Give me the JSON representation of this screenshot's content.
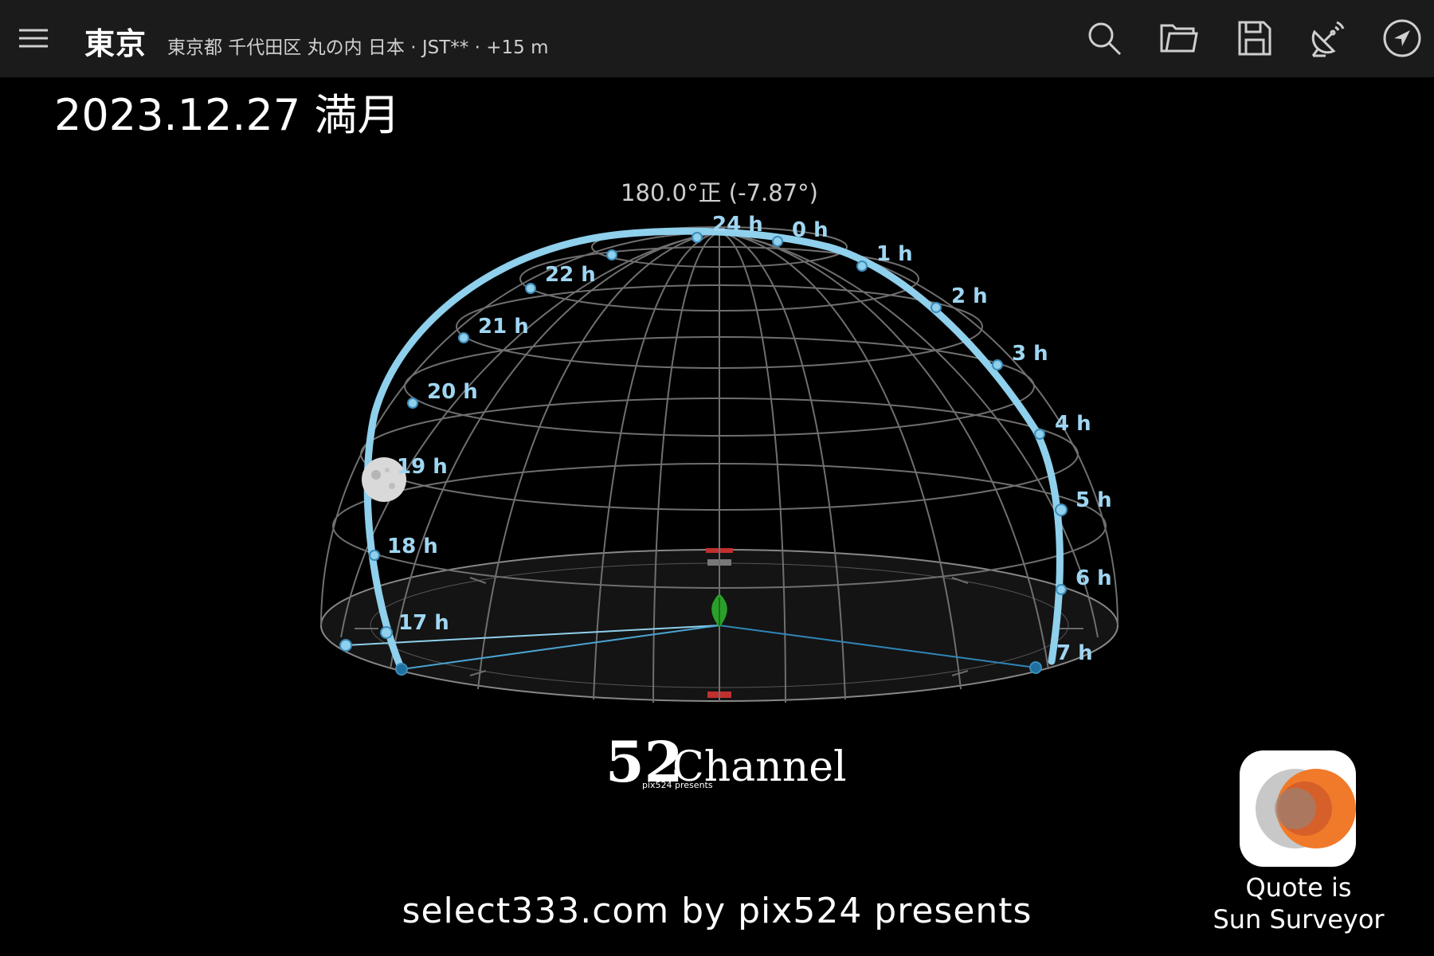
{
  "header": {
    "city": "東京",
    "location": "東京都 千代田区 丸の内 日本 · JST** · +15 m",
    "icons": [
      "menu-icon",
      "search-icon",
      "folder-icon",
      "save-icon",
      "satellite-icon",
      "navigation-icon"
    ]
  },
  "title": "2023.12.27 満月",
  "view": {
    "heading": "180.0°正 (-7.87°)",
    "hour_labels": [
      "24 h",
      "0 h",
      "1 h",
      "2 h",
      "3 h",
      "4 h",
      "5 h",
      "6 h",
      "7 h",
      "22 h",
      "21 h",
      "20 h",
      "19 h",
      "18 h",
      "17 h"
    ],
    "colors": {
      "path": "#8fd0ec",
      "label": "#9fd6f2",
      "grid": "#777777",
      "marker": "#2aa02a",
      "north": "#c0302e"
    }
  },
  "logo": {
    "number": "52",
    "word": "Channel",
    "tagline": "pix524 presents"
  },
  "credit": "select333.com by pix524 presents",
  "app": {
    "quote_line1": "Quote is",
    "quote_line2": "Sun Surveyor"
  }
}
